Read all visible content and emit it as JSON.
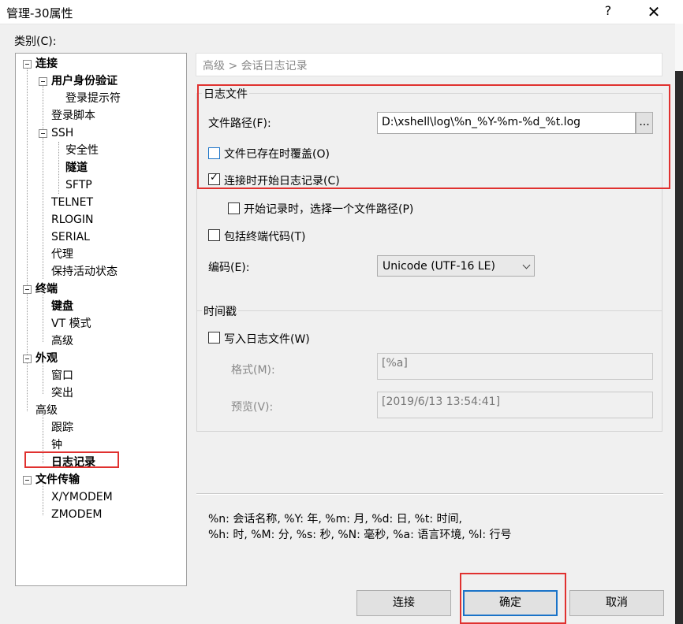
{
  "window": {
    "title": "管理-30属性",
    "help": "?",
    "close": "✕"
  },
  "category_label": "类别(C):",
  "tree": [
    {
      "label": "连接",
      "bold": true
    },
    {
      "label": "用户身份验证",
      "bold": true
    },
    {
      "label": "登录提示符",
      "bold": false
    },
    {
      "label": "登录脚本",
      "bold": false
    },
    {
      "label": "SSH",
      "bold": false
    },
    {
      "label": "安全性",
      "bold": false
    },
    {
      "label": "隧道",
      "bold": true
    },
    {
      "label": "SFTP",
      "bold": false
    },
    {
      "label": "TELNET",
      "bold": false
    },
    {
      "label": "RLOGIN",
      "bold": false
    },
    {
      "label": "SERIAL",
      "bold": false
    },
    {
      "label": "代理",
      "bold": false
    },
    {
      "label": "保持活动状态",
      "bold": false
    },
    {
      "label": "终端",
      "bold": true
    },
    {
      "label": "键盘",
      "bold": true
    },
    {
      "label": "VT 模式",
      "bold": false
    },
    {
      "label": "高级",
      "bold": false
    },
    {
      "label": "外观",
      "bold": true
    },
    {
      "label": "窗口",
      "bold": false
    },
    {
      "label": "突出",
      "bold": false
    },
    {
      "label": "高级",
      "bold": false
    },
    {
      "label": "跟踪",
      "bold": false
    },
    {
      "label": "钟",
      "bold": false
    },
    {
      "label": "日志记录",
      "bold": true
    },
    {
      "label": "文件传输",
      "bold": true
    },
    {
      "label": "X/YMODEM",
      "bold": false
    },
    {
      "label": "ZMODEM",
      "bold": false
    }
  ],
  "header": {
    "breadcrumb": "高级 > 会话日志记录"
  },
  "logfile": {
    "group_title": "日志文件",
    "path_label": "文件路径(F):",
    "path_value": "D:\\xshell\\log\\%n_%Y-%m-%d_%t.log",
    "browse_label": "...",
    "overwrite_label": "文件已存在时覆盖(O)",
    "overwrite_checked": false,
    "start_logging_label": "连接时开始日志记录(C)",
    "start_logging_checked": true,
    "choose_path_label": "开始记录时，选择一个文件路径(P)",
    "choose_path_checked": false,
    "include_terminal_label": "包括终端代码(T)",
    "include_terminal_checked": false,
    "encoding_label": "编码(E):",
    "encoding_value": "Unicode (UTF-16 LE)"
  },
  "timestamp": {
    "group_title": "时间戳",
    "write_label": "写入日志文件(W)",
    "write_checked": false,
    "format_label": "格式(M):",
    "format_value": "[%a]",
    "preview_label": "预览(V):",
    "preview_value": "[2019/6/13 13:54:41]"
  },
  "help_text": {
    "line1": "%n: 会话名称, %Y: 年, %m: 月, %d: 日, %t: 时间,",
    "line2": " %h: 时, %M: 分, %s: 秒, %N: 毫秒, %a: 语言环境, %l: 行号"
  },
  "buttons": {
    "connect": "连接",
    "ok": "确定",
    "cancel": "取消"
  },
  "colors": {
    "highlight_red": "#e0312f",
    "checkbox_blue": "#1a73c8"
  }
}
